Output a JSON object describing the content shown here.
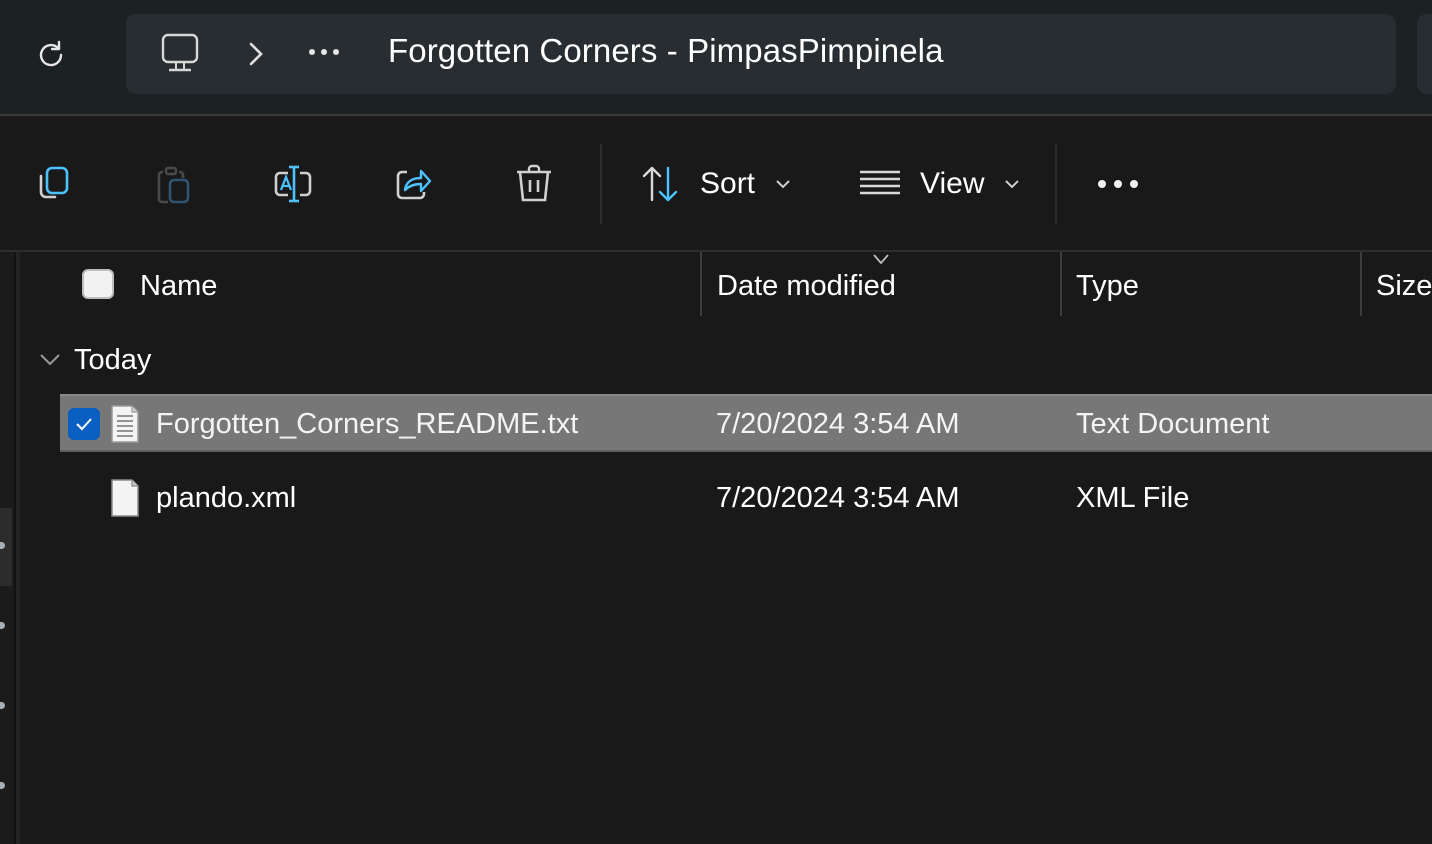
{
  "address_bar": {
    "refresh_label": "Refresh",
    "root_icon": "this-pc-icon",
    "separator_icon": "chevron-right-icon",
    "overflow_label": "...",
    "current_folder": "Forgotten Corners - PimpasPimpinela"
  },
  "toolbar": {
    "buttons": [
      {
        "name": "copy",
        "icon": "copy-icon"
      },
      {
        "name": "paste",
        "icon": "paste-icon",
        "disabled": true
      },
      {
        "name": "rename",
        "icon": "rename-icon"
      },
      {
        "name": "share",
        "icon": "share-icon"
      },
      {
        "name": "delete",
        "icon": "delete-icon"
      }
    ],
    "sort_label": "Sort",
    "view_label": "View",
    "more_label": "See more"
  },
  "columns": {
    "name": "Name",
    "date_modified": "Date modified",
    "type": "Type",
    "size": "Size",
    "sorted_by": "Date modified",
    "sort_direction": "descending"
  },
  "groups": [
    {
      "label": "Today",
      "expanded": true,
      "files": [
        {
          "name": "Forgotten_Corners_README.txt",
          "date_modified": "7/20/2024 3:54 AM",
          "type": "Text Document",
          "size": "",
          "selected": true,
          "icon": "text-document-icon"
        },
        {
          "name": "plando.xml",
          "date_modified": "7/20/2024 3:54 AM",
          "type": "XML File",
          "size": "",
          "selected": false,
          "icon": "blank-document-icon"
        }
      ]
    }
  ],
  "colors": {
    "accent": "#4cc2ff",
    "checkbox_accent": "#0a5fc2",
    "selection_bg": "#777777",
    "background": "#191919",
    "address_region_bg": "#1c2124"
  }
}
